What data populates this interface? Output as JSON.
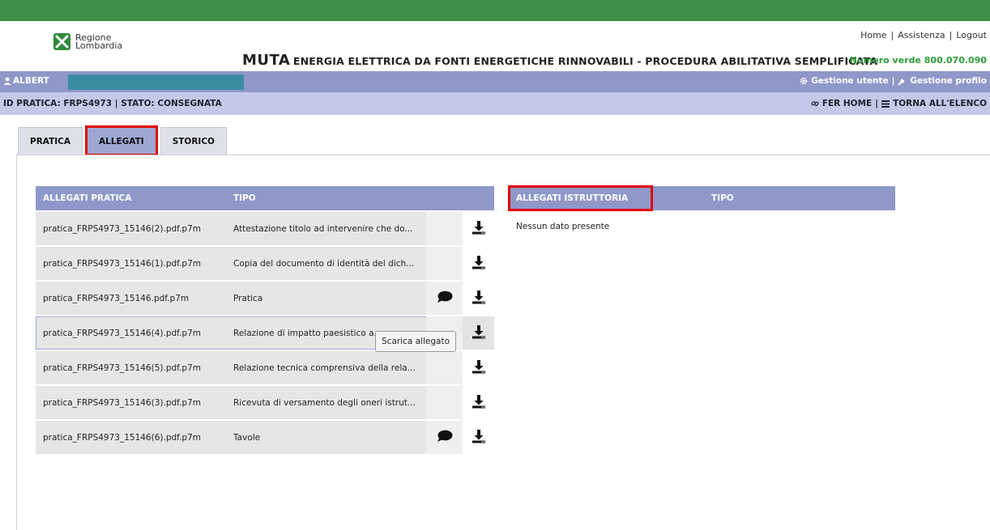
{
  "header": {
    "logo_line1": "Regione",
    "logo_line2": "Lombardia",
    "links": [
      "Home",
      "Assistenza",
      "Logout"
    ],
    "app_title_big": "MUTA",
    "app_title_sub": "ENERGIA ELETTRICA DA FONTI ENERGETICHE RINNOVABILI - PROCEDURA ABILITATIVA SEMPLIFICATA",
    "green_number": "Numero verde 800.070.090"
  },
  "userbar": {
    "user_label": "ALBERT",
    "gestione_utente": "Gestione utente",
    "gestione_profilo": "Gestione profilo",
    "sep": "|"
  },
  "statusbar": {
    "id_pratica": "ID PRATICA: FRPS4973",
    "sep": "|",
    "stato": "STATO: CONSEGNATA",
    "fer_home": "FER HOME",
    "torna": "TORNA ALL'ELENCO"
  },
  "tabs": [
    {
      "label": "PRATICA"
    },
    {
      "label": "ALLEGATI"
    },
    {
      "label": "STORICO"
    }
  ],
  "allegati_pratica": {
    "header_name": "ALLEGATI PRATICA",
    "header_tipo": "TIPO",
    "rows": [
      {
        "name": "pratica_FRPS4973_15146(2).pdf.p7m",
        "tipo": "Attestazione titolo ad intervenire che do..."
      },
      {
        "name": "pratica_FRPS4973_15146(1).pdf.p7m",
        "tipo": "Copia del documento di identità del dich..."
      },
      {
        "name": "pratica_FRPS4973_15146.pdf.p7m",
        "tipo": "Pratica"
      },
      {
        "name": "pratica_FRPS4973_15146(4).pdf.p7m",
        "tipo": "Relazione di impatto paesistico a..."
      },
      {
        "name": "pratica_FRPS4973_15146(5).pdf.p7m",
        "tipo": "Relazione tecnica comprensiva della rela..."
      },
      {
        "name": "pratica_FRPS4973_15146(3).pdf.p7m",
        "tipo": "Ricevuta di versamento degli oneri istrut..."
      },
      {
        "name": "pratica_FRPS4973_15146(6).pdf.p7m",
        "tipo": "Tavole"
      }
    ]
  },
  "allegati_istruttoria": {
    "header_name": "ALLEGATI ISTRUTTORIA",
    "header_tipo": "TIPO",
    "empty_text": "Nessun dato presente"
  },
  "tooltip": "Scarica allegato",
  "icons": {
    "user": "user-icon",
    "gear": "gear-icon",
    "wrench": "wrench-icon",
    "link": "link-icon",
    "list": "list-icon",
    "comment": "comment-icon",
    "download": "download-icon"
  },
  "colors": {
    "topbar": "#3e8e47",
    "userbar": "#8f98c9",
    "statusbar": "#c3c9e6",
    "highlight_red": "#e00000",
    "green_text": "#2e9b3a"
  }
}
